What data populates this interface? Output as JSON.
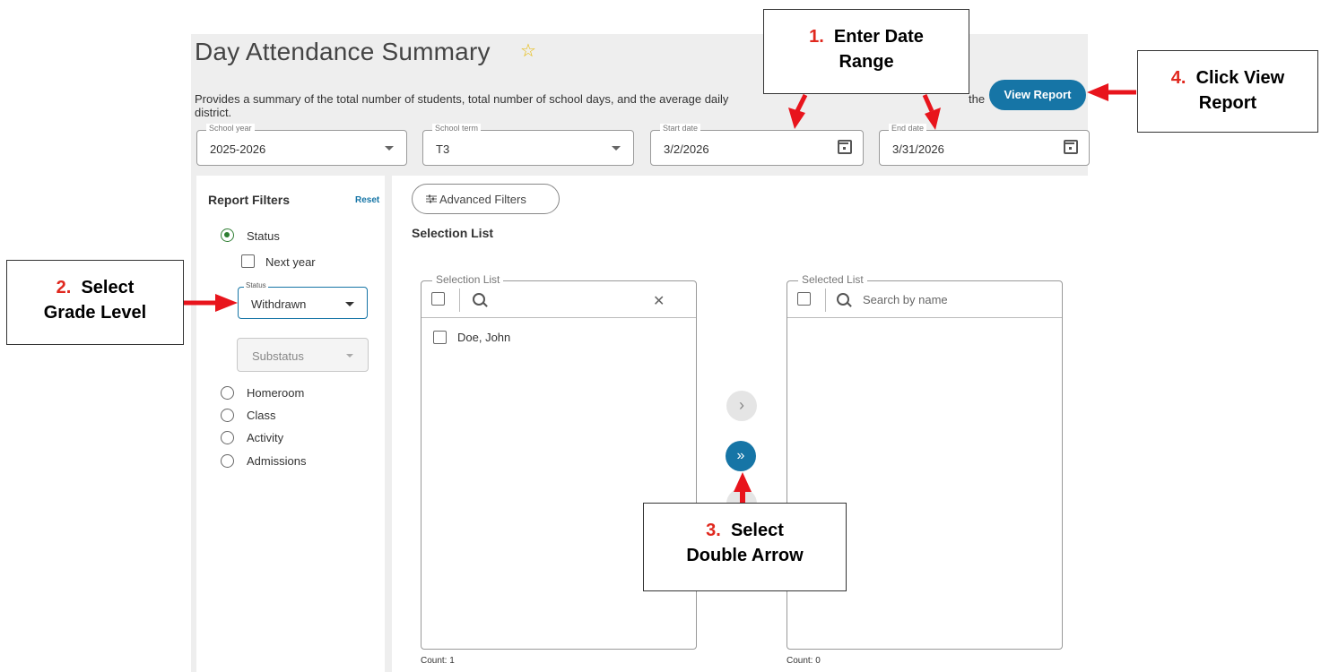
{
  "page": {
    "title": "Day Attendance Summary",
    "description": "Provides a summary of the total number of students, total number of school days, and the average daily",
    "description_line2": "district.",
    "description_end": "the",
    "view_report": "View Report"
  },
  "fields": {
    "school_year": {
      "label": "School year",
      "value": "2025-2026"
    },
    "school_term": {
      "label": "School term",
      "value": "T3"
    },
    "start_date": {
      "label": "Start date",
      "value": "3/2/2026"
    },
    "end_date": {
      "label": "End date",
      "value": "3/31/2026"
    }
  },
  "filters": {
    "title": "Report Filters",
    "reset": "Reset",
    "status_radio": "Status",
    "next_year": "Next year",
    "status_select": {
      "label": "Status",
      "value": "Withdrawn"
    },
    "substatus": "Substatus",
    "options": [
      "Homeroom",
      "Class",
      "Activity",
      "Admissions"
    ]
  },
  "main": {
    "advanced_filters": "Advanced Filters",
    "selection_title": "Selection List",
    "selection_list": {
      "label": "Selection List",
      "items": [
        "Doe, John"
      ],
      "count": "Count: 1"
    },
    "selected_list": {
      "label": "Selected List",
      "placeholder": "Search by name",
      "count": "Count: 0"
    }
  },
  "callouts": {
    "c1": {
      "num": "1.",
      "line1": "Enter Date",
      "line2": "Range"
    },
    "c2": {
      "num": "2.",
      "line1": "Select",
      "line2": "Grade Level"
    },
    "c3": {
      "num": "3.",
      "line1": "Select",
      "line2": "Double Arrow"
    },
    "c4": {
      "num": "4.",
      "line1": "Click View",
      "line2": "Report"
    }
  },
  "colors": {
    "accent": "#1675a6",
    "callout_number": "#e0281e",
    "arrow": "#e8141c",
    "radio_selected": "#2e7d32",
    "star": "#e6b800"
  }
}
